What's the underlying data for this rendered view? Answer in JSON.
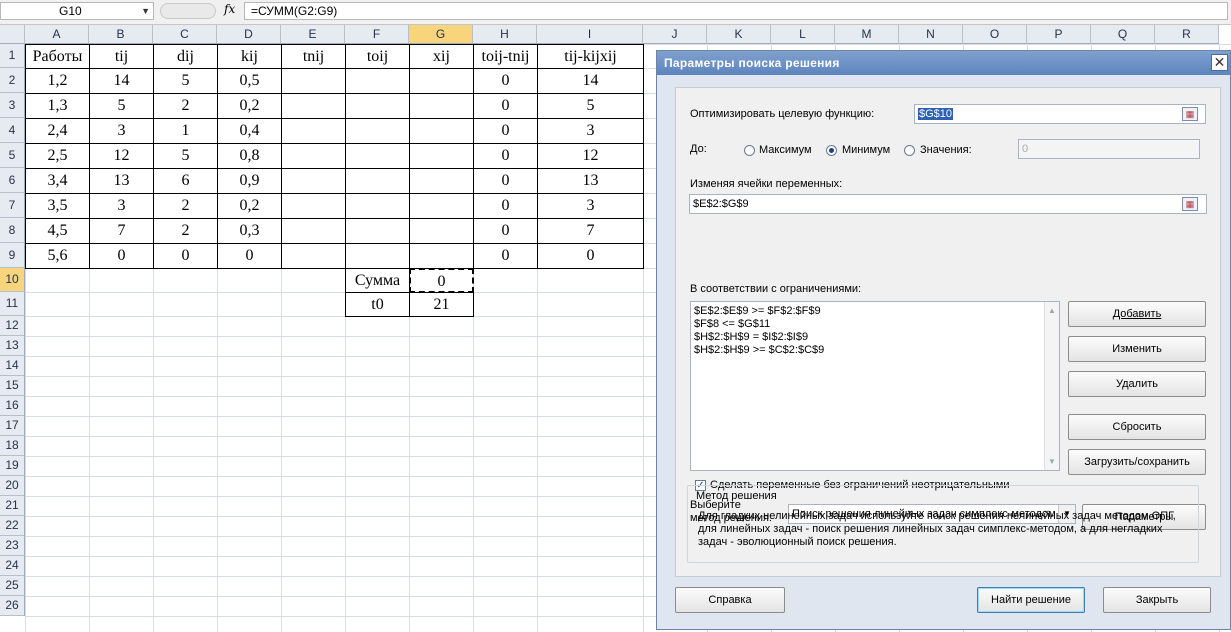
{
  "formula_bar": {
    "name_box": "G10",
    "fx": "fx",
    "formula": "=СУММ(G2:G9)"
  },
  "columns": [
    "A",
    "B",
    "C",
    "D",
    "E",
    "F",
    "G",
    "H",
    "I",
    "J",
    "K",
    "L",
    "M",
    "N",
    "O",
    "P",
    "Q",
    "R"
  ],
  "rows": [
    "1",
    "2",
    "3",
    "4",
    "5",
    "6",
    "7",
    "8",
    "9",
    "10",
    "11",
    "12",
    "13",
    "14",
    "15",
    "16",
    "17",
    "18",
    "19",
    "20",
    "21",
    "22",
    "23",
    "24",
    "25",
    "26"
  ],
  "table": {
    "headers": [
      "Работы",
      "tij",
      "dij",
      "kij",
      "tnij",
      "toij",
      "xij",
      "toij-tnij",
      "tij-kijxij"
    ],
    "rows": [
      [
        "1,2",
        "14",
        "5",
        "0,5",
        "",
        "",
        "",
        "0",
        "14"
      ],
      [
        "1,3",
        "5",
        "2",
        "0,2",
        "",
        "",
        "",
        "0",
        "5"
      ],
      [
        "2,4",
        "3",
        "1",
        "0,4",
        "",
        "",
        "",
        "0",
        "3"
      ],
      [
        "2,5",
        "12",
        "5",
        "0,8",
        "",
        "",
        "",
        "0",
        "12"
      ],
      [
        "3,4",
        "13",
        "6",
        "0,9",
        "",
        "",
        "",
        "0",
        "13"
      ],
      [
        "3,5",
        "3",
        "2",
        "0,2",
        "",
        "",
        "",
        "0",
        "3"
      ],
      [
        "4,5",
        "7",
        "2",
        "0,3",
        "",
        "",
        "",
        "0",
        "7"
      ],
      [
        "5,6",
        "0",
        "0",
        "0",
        "",
        "",
        "",
        "0",
        "0"
      ]
    ],
    "sum_label": "Сумма",
    "sum_value": "0",
    "t0_label": "t0",
    "t0_value": "21"
  },
  "dialog": {
    "title": "Параметры поиска решения",
    "close": "✕",
    "objective_label": "Оптимизировать целевую функцию:",
    "objective_value": "$G$10",
    "to_label": "До:",
    "radio_max": "Максимум",
    "radio_min": "Минимум",
    "radio_value": "Значения:",
    "value_field": "0",
    "selected_goal": "Минимум",
    "changing_label": "Изменяя ячейки переменных:",
    "changing_value": "$E$2:$G$9",
    "constraints_label": "В соответствии с ограничениями:",
    "constraints": [
      "$E$2:$E$9 >= $F$2:$F$9",
      "$F$8 <= $G$11",
      "$H$2:$H$9 = $I$2:$I$9",
      "$H$2:$H$9 >= $C$2:$C$9"
    ],
    "btn_add": "Добавить",
    "btn_change": "Изменить",
    "btn_delete": "Удалить",
    "btn_reset": "Сбросить",
    "btn_load_save": "Загрузить/сохранить",
    "nonneg_label": "Сделать переменные без ограничений неотрицательными",
    "nonneg_checked": true,
    "method_label_1": "Выберите",
    "method_label_2": "метод решения:",
    "method_value": "Поиск решения линейных задач симплекс-методом",
    "btn_params": "Параметры",
    "method_box_title": "Метод решения",
    "method_box_desc": "Для гладких нелинейных задач используйте поиск решения нелинейных задач методом ОПГ, для линейных задач - поиск решения линейных задач симплекс-методом, а для негладких задач - эволюционный поиск решения.",
    "btn_help": "Справка",
    "btn_solve": "Найти решение",
    "btn_close": "Закрыть"
  }
}
